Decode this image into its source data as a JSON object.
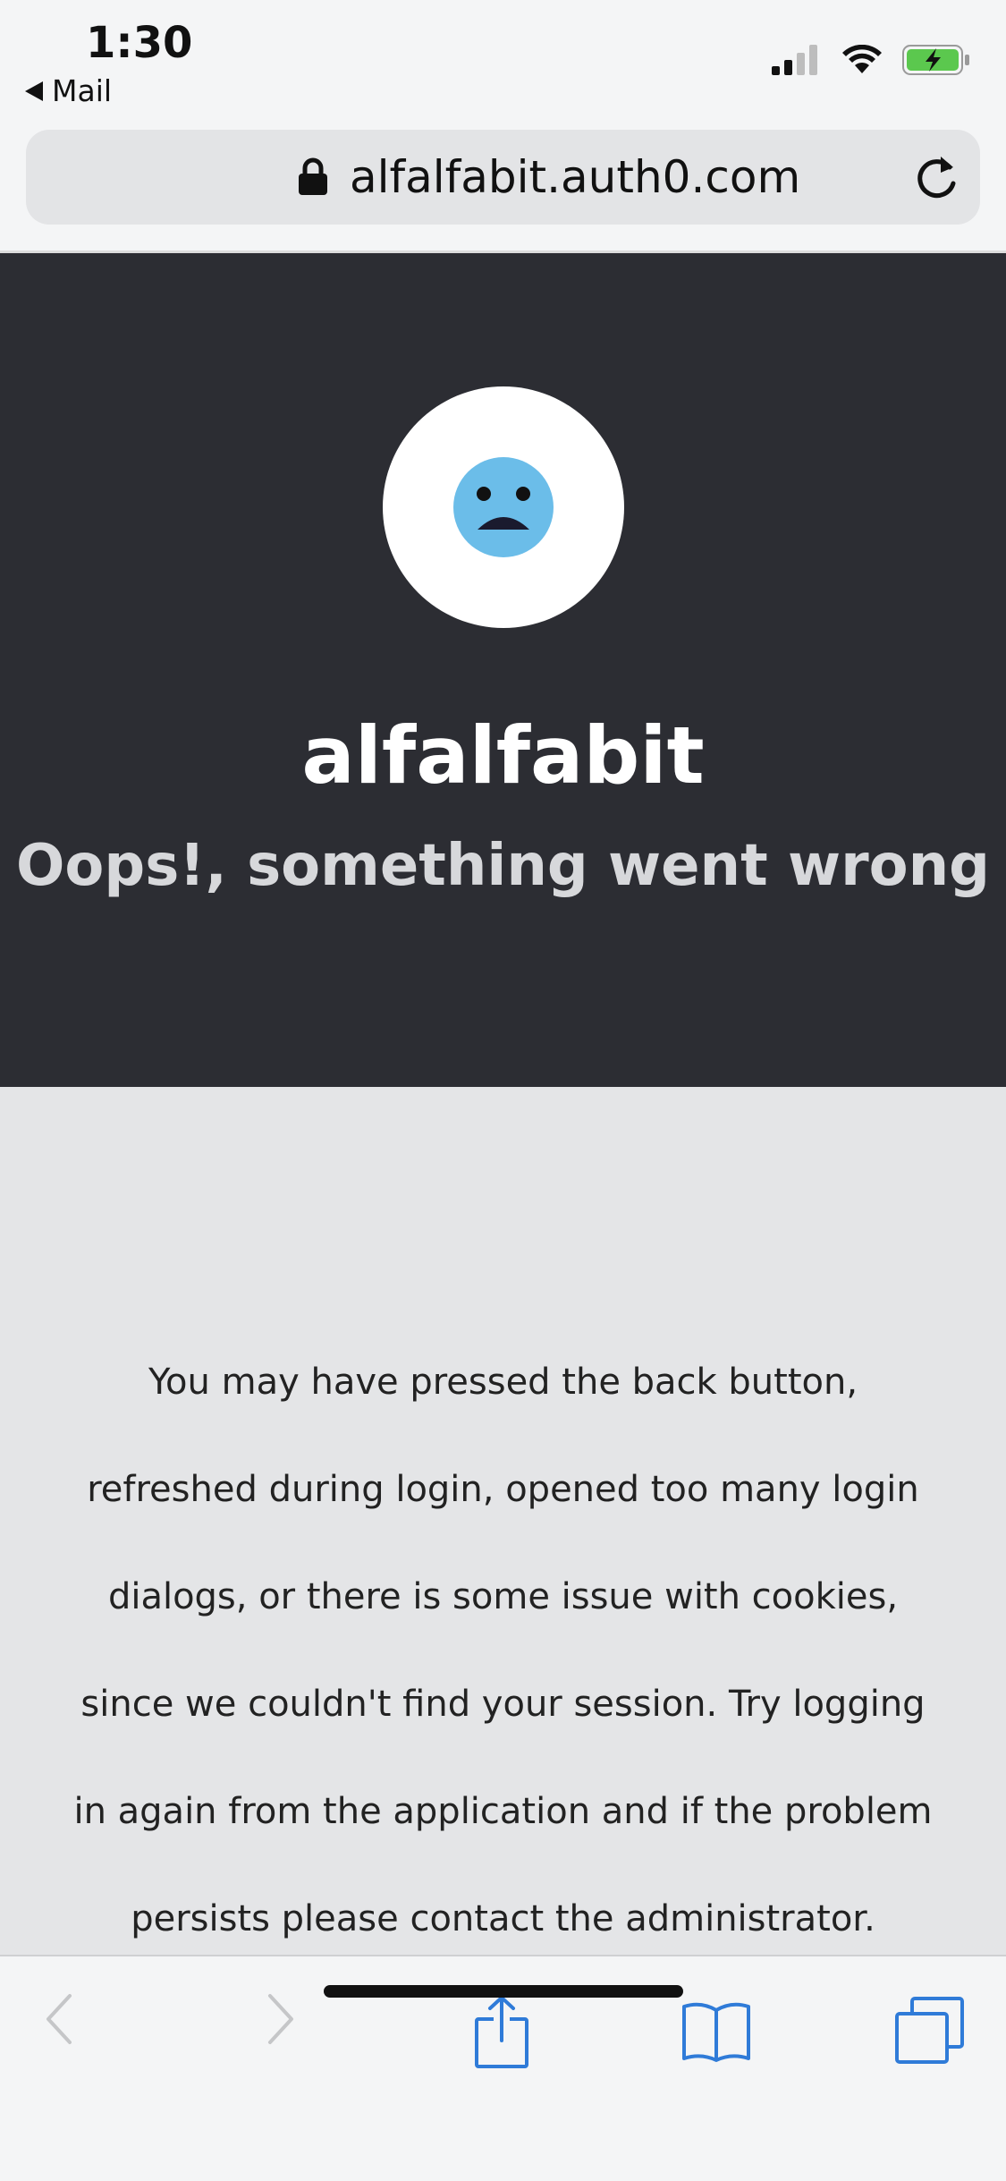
{
  "status": {
    "time": "1:30",
    "back_label": "Mail"
  },
  "browser": {
    "url": "alfalfabit.auth0.com"
  },
  "hero": {
    "brand": "alfalfabit",
    "title": "Oops!, something went wrong"
  },
  "message": "You may have pressed the back button, refreshed during login, opened too many login dialogs, or there is some issue with cookies, since we couldn't find your session. Try logging in again from the application and if the problem persists please contact the administrator.",
  "colors": {
    "hero_bg": "#2c2d33",
    "content_bg": "#e4e5e7",
    "face": "#6bbde9",
    "battery": "#5bc84e",
    "toolbar_icon": "#2f7bd8"
  },
  "icons": {
    "lock": "lock-icon",
    "reload": "reload-icon",
    "signal": "signal-icon",
    "wifi": "wifi-icon",
    "battery": "battery-charging-icon",
    "back": "back-arrow-icon",
    "forward": "forward-arrow-icon",
    "share": "share-icon",
    "bookmarks": "bookmarks-icon",
    "tabs": "tabs-icon",
    "face": "sad-face-icon"
  }
}
